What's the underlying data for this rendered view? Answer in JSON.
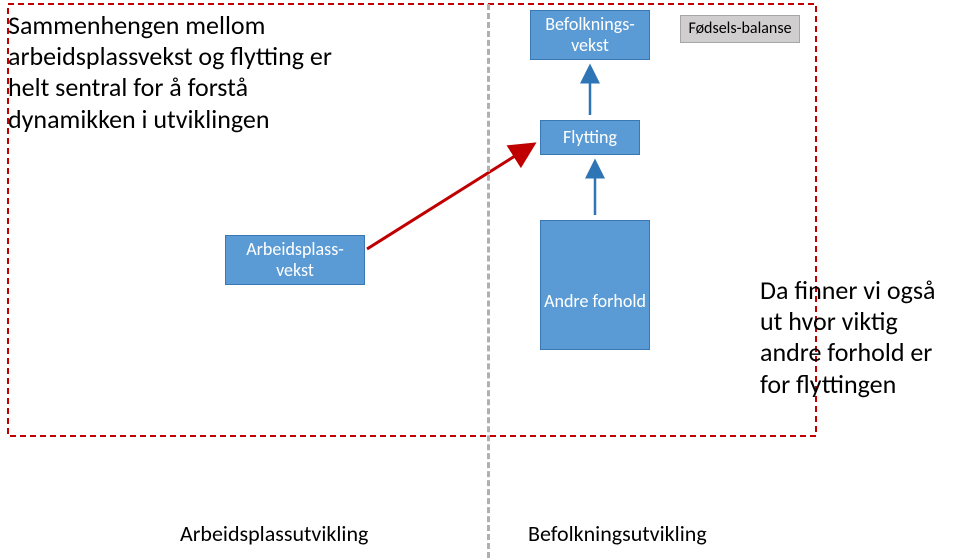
{
  "title_left": "Sammenhengen mellom arbeidsplassvekst og flytting er helt sentral for å forstå dynamikken i utviklingen",
  "title_right": "Da finner vi også ut hvor viktig andre forhold er for flyttingen",
  "boxes": {
    "befolkningsvekst": "Befolknings-\nvekst",
    "fodselsbalanse": "Fødsels-balanse",
    "flytting": "Flytting",
    "arbeidsplassvekst": "Arbeidsplass-\nvekst",
    "andre_forhold": "Andre forhold"
  },
  "labels": {
    "left": "Arbeidsplassutvikling",
    "right": "Befolkningsutvikling"
  }
}
